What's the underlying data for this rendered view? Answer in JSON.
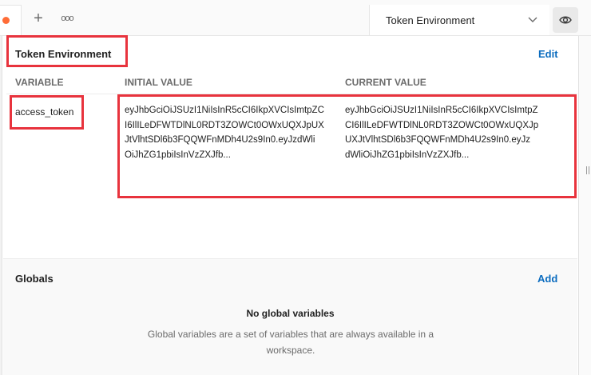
{
  "tabs": {
    "new_tab_icon": "plus-icon",
    "more_icon": "ellipsis-icon",
    "plus_glyph": "+",
    "more_glyph": "ooo",
    "accent_color": "#ff6c37"
  },
  "environment_selector": {
    "selected": "Token Environment",
    "quick_look_icon": "eye-icon"
  },
  "environment": {
    "name": "Token Environment",
    "edit_label": "Edit",
    "columns": [
      "VARIABLE",
      "INITIAL VALUE",
      "CURRENT VALUE"
    ],
    "variables": [
      {
        "name": "access_token",
        "initial_value": "eyJhbGciOiJSUzI1NiIsInR5cCI6IkpXVCIsImtpZC\nI6IlILeDFWTDlNL0RDT3ZOWCt0OWxUQXJpUX\nJtVlhtSDl6b3FQQWFnMDh4U2s9In0.eyJzdWli\nOiJhZG1pbiIsInVzZXJfb...",
        "current_value": "eyJhbGciOiJSUzI1NiIsInR5cCI6IkpXVCIsImtpZ\nCI6IlILeDFWTDlNL0RDT3ZOWCt0OWxUQXJp\nUXJtVlhtSDl6b3FQQWFnMDh4U2s9In0.eyJz\ndWliOiJhZG1pbiIsInVzZXJfb..."
      }
    ]
  },
  "globals": {
    "title": "Globals",
    "add_label": "Add",
    "empty_title": "No global variables",
    "empty_description": "Global variables are a set of variables that are always available in a workspace."
  },
  "annotation_color": "#e8333d",
  "link_color": "#0b6cbf"
}
